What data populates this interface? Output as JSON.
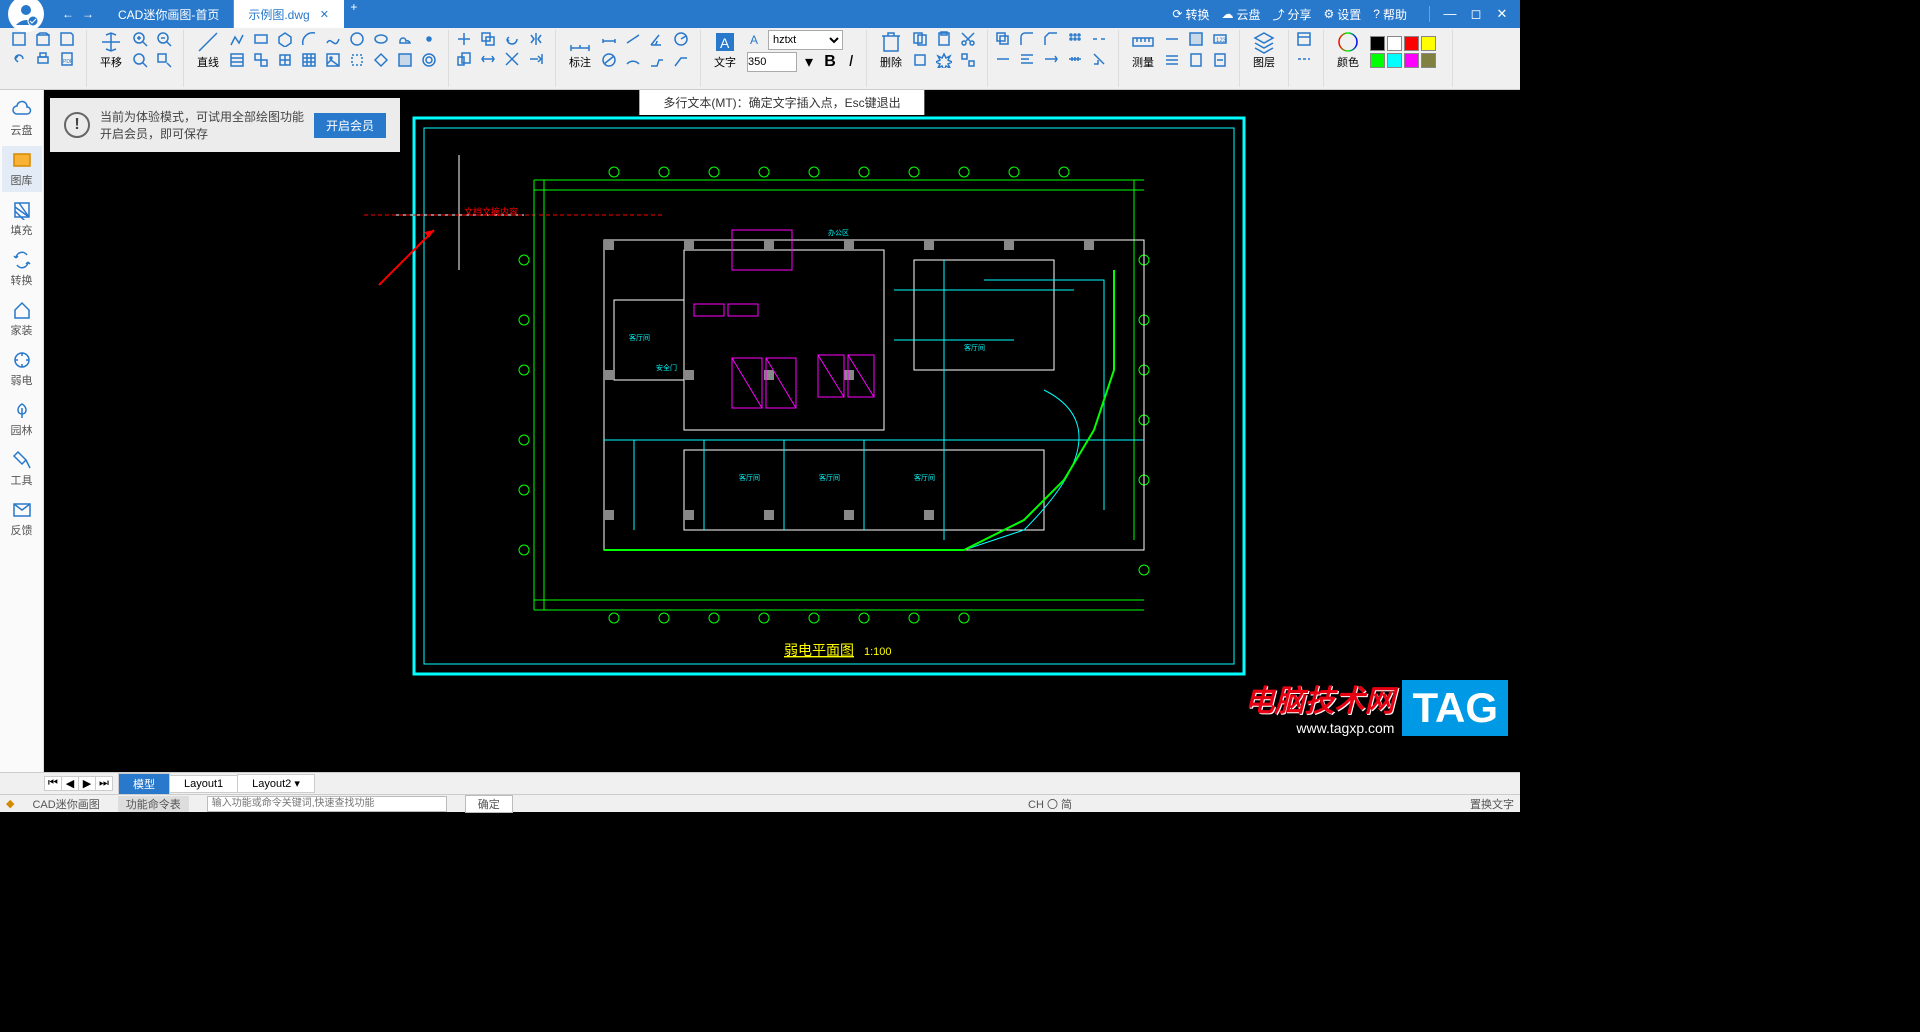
{
  "title_tabs": {
    "home": "CAD迷你画图-首页",
    "file": "示例图.dwg"
  },
  "title_right": {
    "convert": "转换",
    "cloud": "云盘",
    "share": "分享",
    "settings": "设置",
    "help": "帮助"
  },
  "ribbon": {
    "pan": "平移",
    "line": "直线",
    "dim": "标注",
    "text": "文字",
    "font": "hztxt",
    "size": "350",
    "delete": "删除",
    "measure": "测量",
    "layer": "图层",
    "color": "颜色"
  },
  "sidebar": {
    "cloud": "云盘",
    "lib": "图库",
    "fill": "填充",
    "convert": "转换",
    "home": "家装",
    "elec": "弱电",
    "garden": "园林",
    "tools": "工具",
    "feedback": "反馈"
  },
  "hint": "多行文本(MT)：确定文字插入点，Esc键退出",
  "trial": {
    "line1": "当前为体验模式，可试用全部绘图功能",
    "line2": "开启会员，即可保存",
    "btn": "开启会员"
  },
  "drawing": {
    "title": "弱电平面图",
    "scale": "1:100",
    "text_cursor": "文档文摘内容"
  },
  "layouts": {
    "model": "模型",
    "l1": "Layout1",
    "l2": "Layout2"
  },
  "status": {
    "app": "CAD迷你画图",
    "funcs": "功能命令表",
    "placeholder": "输入功能或命令关键词,快速查找功能",
    "ok": "确定",
    "lang": "CH 〇 简",
    "right": "置换文字"
  },
  "watermark": {
    "l1": "电脑技术网",
    "l2": "www.tagxp.com",
    "tag": "TAG"
  },
  "colors": [
    "#000",
    "#fff",
    "#f00",
    "#ff0",
    "#0f0",
    "#0ff",
    "#f0f",
    "#808040"
  ]
}
